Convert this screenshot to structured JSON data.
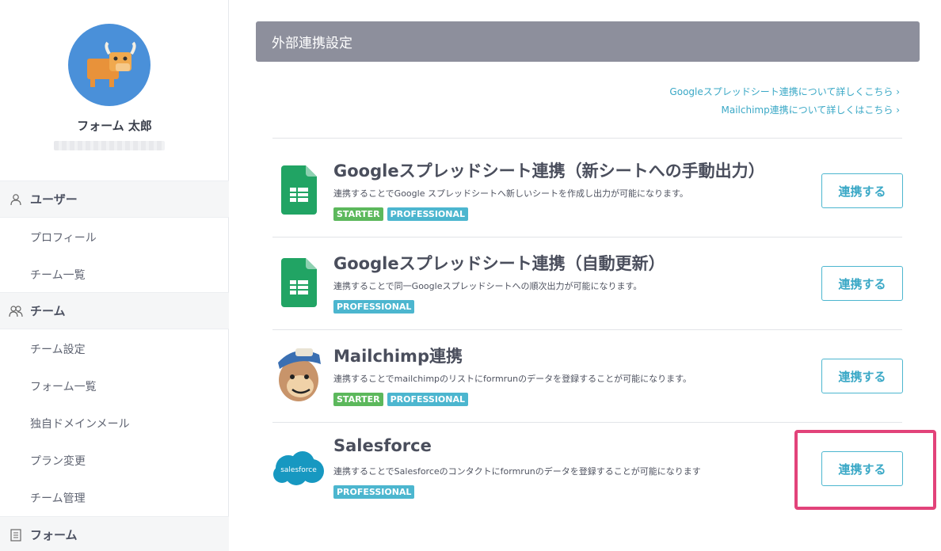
{
  "sidebar": {
    "user_name": "フォーム 太郎",
    "sections": [
      {
        "label": "ユーザー",
        "icon": "user-icon",
        "items": [
          "プロフィール",
          "チーム一覧"
        ]
      },
      {
        "label": "チーム",
        "icon": "team-icon",
        "items": [
          "チーム設定",
          "フォーム一覧",
          "独自ドメインメール",
          "プラン変更",
          "チーム管理"
        ]
      },
      {
        "label": "フォーム",
        "icon": "document-icon",
        "items": []
      }
    ]
  },
  "main": {
    "header": "外部連携設定",
    "links": [
      "Googleスプレッドシート連携について詳しくこちら ›",
      "Mailchimp連携について詳しくはこちら ›"
    ],
    "integrations": [
      {
        "title": "Googleスプレッドシート連携（新シートへの手動出力）",
        "description": "連携することでGoogle スプレッドシートへ新しいシートを作成し出力が可能になります。",
        "badges": [
          "STARTER",
          "PROFESSIONAL"
        ],
        "button": "連携する",
        "icon": "google-sheets-icon"
      },
      {
        "title": "Googleスプレッドシート連携（自動更新）",
        "description": "連携することで同一Googleスプレッドシートへの順次出力が可能になります。",
        "badges": [
          "PROFESSIONAL"
        ],
        "button": "連携する",
        "icon": "google-sheets-icon"
      },
      {
        "title": "Mailchimp連携",
        "description": "連携することでmailchimpのリストにformrunのデータを登録することが可能になります。",
        "badges": [
          "STARTER",
          "PROFESSIONAL"
        ],
        "button": "連携する",
        "icon": "mailchimp-icon"
      },
      {
        "title": "Salesforce",
        "description": "連携することでSalesforceのコンタクトにformrunのデータを登録することが可能になります",
        "badges": [
          "PROFESSIONAL"
        ],
        "button": "連携する",
        "icon": "salesforce-icon",
        "logo_text": "salesforce"
      }
    ]
  },
  "colors": {
    "accent": "#4cb6cf",
    "starter": "#5cb85c",
    "header": "#8d8f9c",
    "highlight": "#e2437a"
  }
}
